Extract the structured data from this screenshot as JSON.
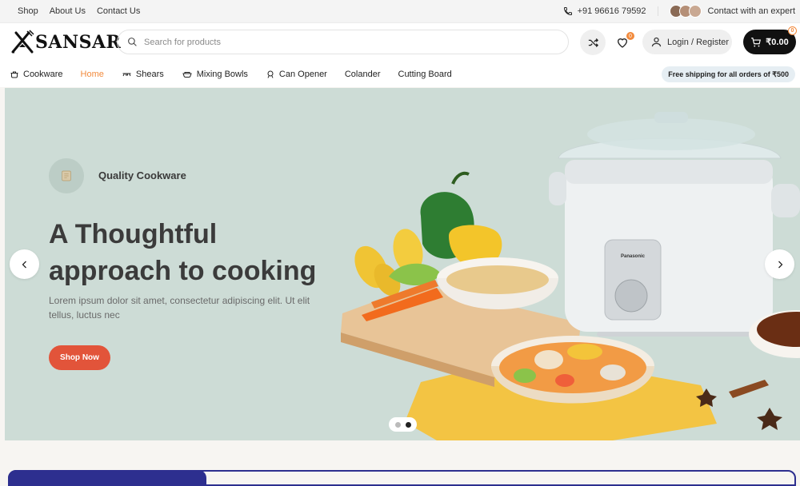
{
  "topbar": {
    "links": [
      "Shop",
      "About Us",
      "Contact Us"
    ],
    "phone": "+91 96616 79592",
    "contact_expert": "Contact with an expert"
  },
  "header": {
    "logo": "SANSAR",
    "search_placeholder": "Search for products",
    "wishlist_count": "0",
    "login_label": "Login / Register",
    "cart_total": "₹0.00",
    "cart_count": "0"
  },
  "nav": {
    "items": [
      {
        "label": "Cookware",
        "icon": "pot-icon"
      },
      {
        "label": "Home",
        "icon": ""
      },
      {
        "label": "Shears",
        "icon": "shears-icon"
      },
      {
        "label": "Mixing Bowls",
        "icon": "bowl-icon"
      },
      {
        "label": "Can Opener",
        "icon": "can-opener-icon"
      },
      {
        "label": "Colander",
        "icon": ""
      },
      {
        "label": "Cutting Board",
        "icon": ""
      }
    ],
    "active": "Home",
    "shipping_note": "Free shipping for all orders of ₹500"
  },
  "hero": {
    "kicker": "Quality Cookware",
    "headline_line1": "A Thoughtful",
    "headline_line2": "approach to cooking",
    "subtext": "Lorem ipsum dolor sit amet, consectetur adipiscing elit. Ut elit tellus, luctus nec",
    "cta": "Shop Now",
    "appliance_brand": "Panasonic",
    "slides": 2,
    "active_slide": 2
  },
  "colors": {
    "accent": "#f28a3c",
    "cta": "#e2543a",
    "hero_bg": "#cddcd6",
    "dark": "#111111",
    "strip": "#2d2f8f"
  }
}
